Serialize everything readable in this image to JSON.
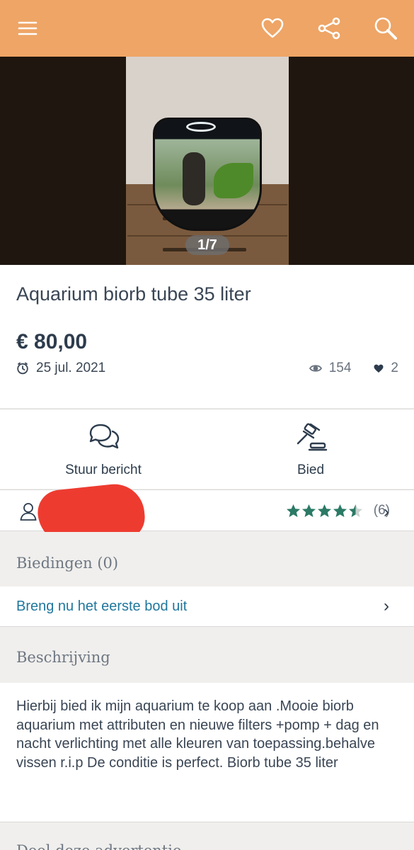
{
  "header": {
    "menu_icon": "hamburger-menu-icon",
    "favorite_icon": "heart-outline-icon",
    "share_icon": "share-icon",
    "search_icon": "search-icon",
    "bar_color": "#eea566"
  },
  "gallery": {
    "counter": "1/7"
  },
  "listing": {
    "title": "Aquarium biorb tube 35 liter",
    "price": "€ 80,00",
    "date": "25 jul. 2021",
    "views": "154",
    "favorites": "2"
  },
  "actions": {
    "message_label": "Stuur bericht",
    "bid_label": "Bied"
  },
  "seller": {
    "rating_value": 4.5,
    "rating_count": "(6)",
    "star_color": "#2b7a66"
  },
  "bids": {
    "heading": "Biedingen (0)",
    "cta": "Breng nu het eerste bod uit",
    "cta_color": "#20779d"
  },
  "description": {
    "heading": "Beschrijving",
    "text": "Hierbij bied ik mijn aquarium te koop aan .Mooie biorb aquarium met attributen en nieuwe filters +pomp + dag en nacht verlichting met alle kleuren van toepassing.behalve vissen r.i.p De conditie is perfect. Biorb tube 35 liter"
  },
  "share_section": {
    "heading": "Deel deze advertentie"
  }
}
